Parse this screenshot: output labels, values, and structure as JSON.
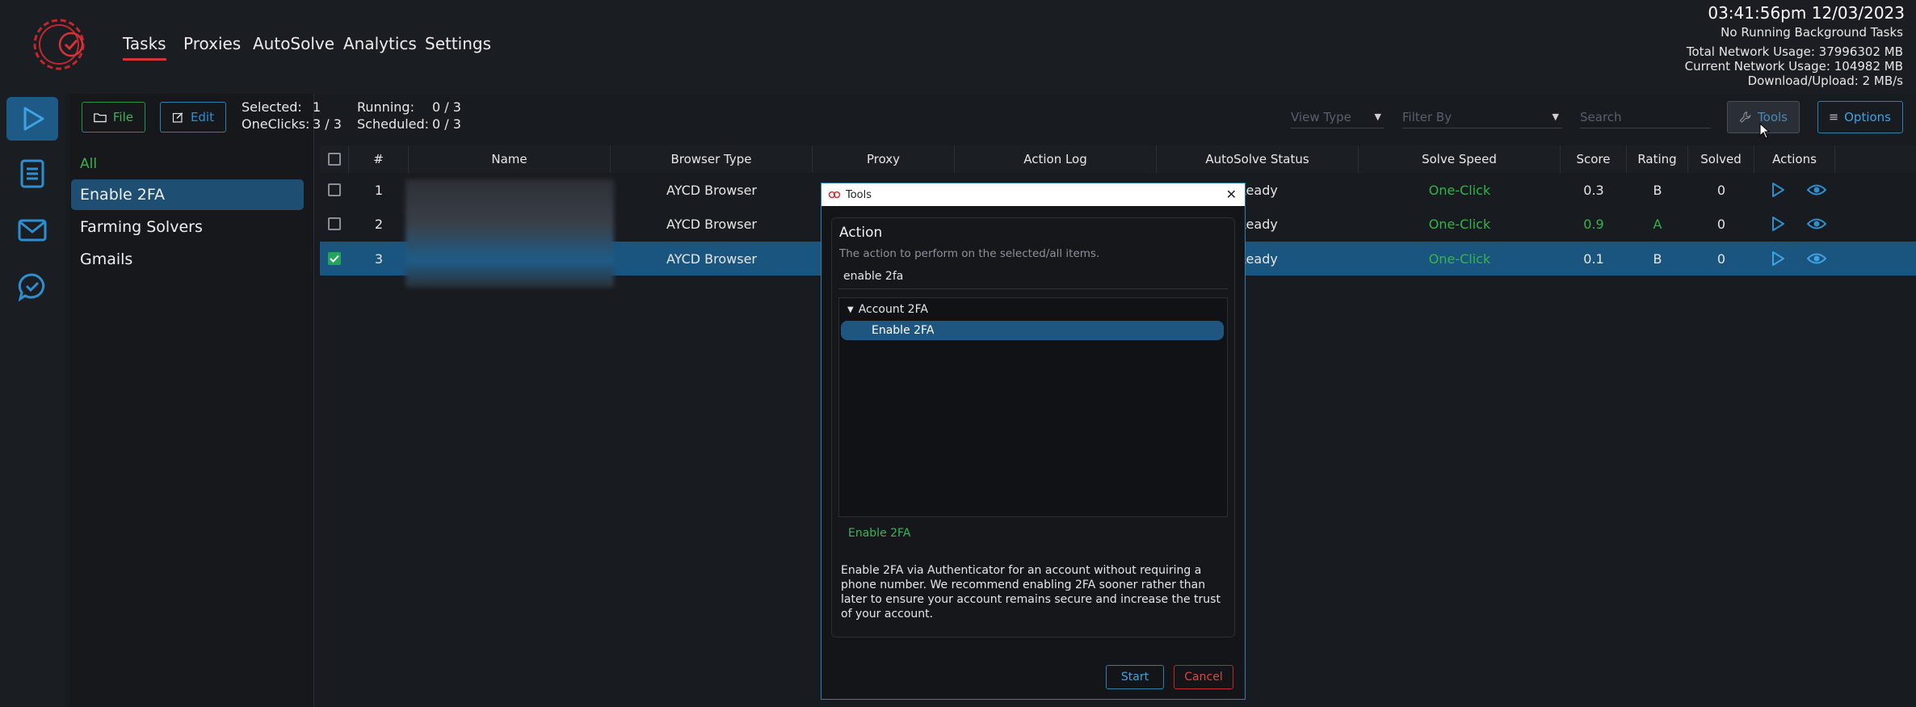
{
  "nav": {
    "tabs": [
      "Tasks",
      "Proxies",
      "AutoSolve",
      "Analytics",
      "Settings"
    ]
  },
  "status": {
    "clock": "03:41:56pm 12/03/2023",
    "background": "No Running Background Tasks",
    "total_network": "Total Network Usage:  37996302 MB",
    "current_network": "Current Network Usage:  104982 MB",
    "download_upload": "Download/Upload:  2 MB/s"
  },
  "groups": [
    "All",
    "Enable 2FA",
    "Farming Solvers",
    "Gmails"
  ],
  "toolbar": {
    "file": "File",
    "edit": "Edit",
    "selected_label": "Selected:",
    "selected_value": "1",
    "oneclicks_label": "OneClicks:",
    "oneclicks_value": "3 / 3",
    "running_label": "Running:",
    "running_value": "0 / 3",
    "scheduled_label": "Scheduled:",
    "scheduled_value": "0 / 3",
    "view_type": "View Type",
    "filter_by": "Filter By",
    "search_placeholder": "Search",
    "tools": "Tools",
    "options": "Options"
  },
  "table": {
    "headers": [
      "#",
      "Name",
      "Browser Type",
      "Proxy",
      "Action Log",
      "AutoSolve Status",
      "Solve Speed",
      "Score",
      "Rating",
      "Solved",
      "Actions"
    ],
    "rows": [
      {
        "num": "1",
        "browser": "AYCD Browser",
        "status": "Ready",
        "speed": "One-Click",
        "score": "0.3",
        "rating": "B",
        "solved": "0",
        "checked": false
      },
      {
        "num": "2",
        "browser": "AYCD Browser",
        "status": "Ready",
        "speed": "One-Click",
        "score": "0.9",
        "rating": "A",
        "solved": "0",
        "checked": false
      },
      {
        "num": "3",
        "browser": "AYCD Browser",
        "status": "Ready",
        "speed": "One-Click",
        "score": "0.1",
        "rating": "B",
        "solved": "0",
        "checked": true
      }
    ]
  },
  "dialog": {
    "title": "Tools",
    "heading": "Action",
    "subtitle": "The action to perform on the selected/all items.",
    "search_value": "enable 2fa",
    "tree_group": "Account 2FA",
    "tree_item": "Enable 2FA",
    "selected_action": "Enable 2FA",
    "description": "Enable 2FA via Authenticator for an account without requiring a phone number. We recommend enabling 2FA sooner rather than later to ensure your account remains secure and increase the trust of your account.",
    "start": "Start",
    "cancel": "Cancel"
  },
  "colors": {
    "accent_red": "#d43338",
    "accent_blue": "#2e8fd0",
    "selection_blue": "#1a5580",
    "green": "#36b34a"
  },
  "icons": [
    "logo-gear-check-icon",
    "play-icon",
    "document-icon",
    "mail-icon",
    "chat-check-icon",
    "folder-icon",
    "edit-icon",
    "wrench-icon",
    "menu-icon",
    "eye-icon",
    "close-icon",
    "checkmark-icon"
  ]
}
